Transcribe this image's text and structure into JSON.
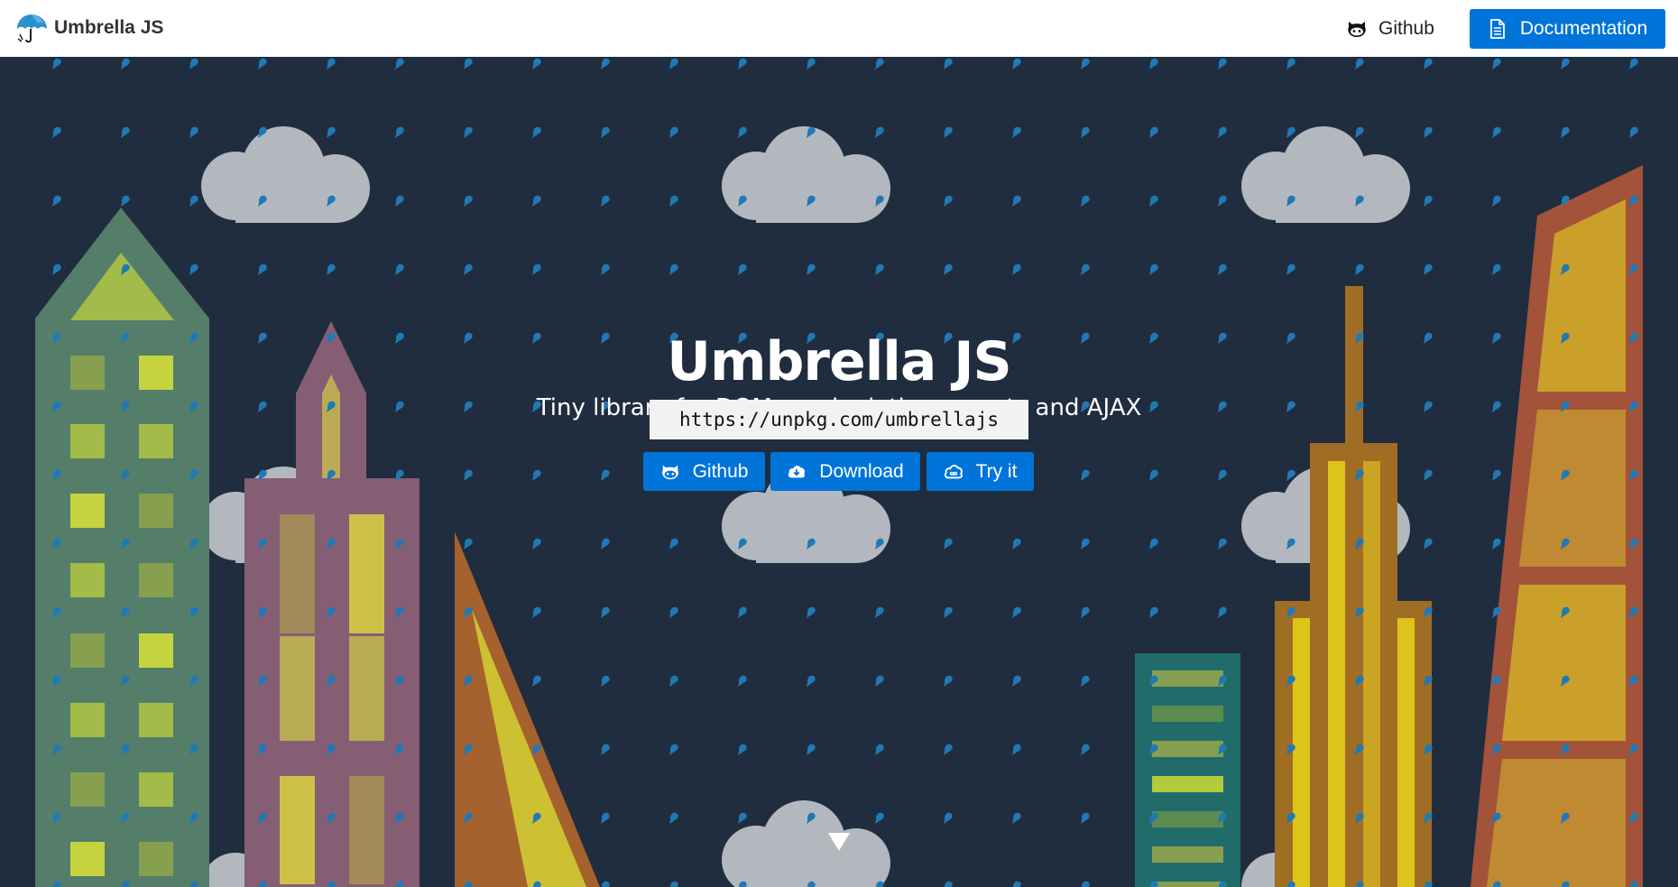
{
  "header": {
    "brand": "Umbrella JS",
    "nav_github": "Github",
    "nav_docs": "Documentation"
  },
  "hero": {
    "title": "Umbrella JS",
    "subtitle": "Tiny library for DOM manipulation, events and AJAX",
    "cdn_url": "https://unpkg.com/umbrellajs",
    "buttons": {
      "github": "Github",
      "download": "Download",
      "try": "Try it"
    }
  },
  "colors": {
    "accent": "#0074d9",
    "background": "#202d3f",
    "rain": "#2079b5",
    "cloud": "#b3b8be"
  },
  "icons": {
    "brand": "umbrella-icon",
    "github": "github-icon",
    "docs": "document-icon",
    "download": "cloud-download-icon",
    "try": "cloud-icon"
  }
}
